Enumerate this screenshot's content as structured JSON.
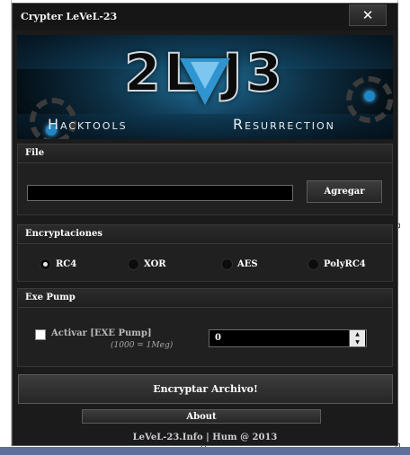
{
  "window": {
    "title": "Crypter LeVeL-23",
    "close_label": "✕"
  },
  "banner": {
    "logo_text": "2L  J3",
    "sub_left": "Hacktools",
    "sub_right": "Resurrection"
  },
  "file_section": {
    "header": "File",
    "path_value": "",
    "add_button": "Agregar"
  },
  "encryption_section": {
    "header": "Encryptaciones",
    "options": [
      {
        "label": "RC4",
        "checked": true
      },
      {
        "label": "XOR",
        "checked": false
      },
      {
        "label": "AES",
        "checked": false
      },
      {
        "label": "PolyRC4",
        "checked": false
      }
    ]
  },
  "exe_pump_section": {
    "header": "Exe Pump",
    "checkbox_label": "Activar [EXE Pump]",
    "checkbox_checked": false,
    "hint": "(1000 = 1Meg)",
    "value": "0"
  },
  "actions": {
    "encrypt_button": "Encryptar Archivo!",
    "about_button": "About"
  },
  "footer": {
    "credits": "LeVeL-23.Info | Hum @ 2013"
  },
  "colors": {
    "accent": "#2f94cf",
    "background": "#1b1b1b"
  }
}
